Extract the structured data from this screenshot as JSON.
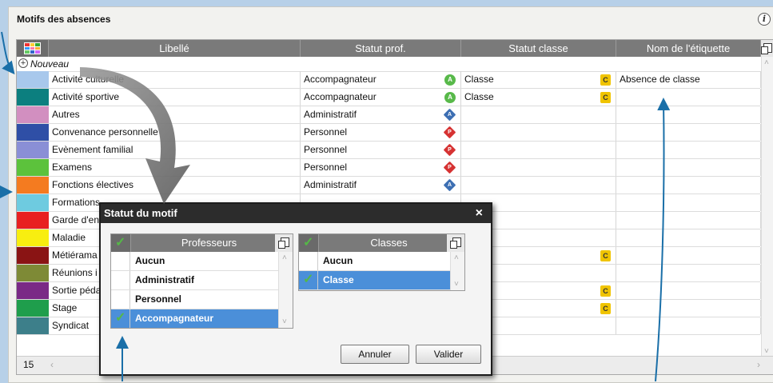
{
  "panel": {
    "title": "Motifs des absences",
    "info_icon": "info-icon"
  },
  "table": {
    "columns": [
      "Libellé",
      "Statut prof.",
      "Statut classe",
      "Nom de l'étiquette"
    ],
    "new_label": "Nouveau",
    "rows": [
      {
        "color": "#a8c8ec",
        "label": "Activité culturelle",
        "prof": "Accompagnateur",
        "prof_badge": "circle",
        "prof_letter": "A",
        "classe": "Classe",
        "classe_badge": "C",
        "etiquette": "Absence de classe"
      },
      {
        "color": "#0c7f7f",
        "label": "Activité sportive",
        "prof": "Accompagnateur",
        "prof_badge": "circle",
        "prof_letter": "A",
        "classe": "Classe",
        "classe_badge": "C",
        "etiquette": ""
      },
      {
        "color": "#d28fc0",
        "label": "Autres",
        "prof": "Administratif",
        "prof_badge": "diamond-blue",
        "prof_letter": "A",
        "classe": "",
        "classe_badge": "",
        "etiquette": ""
      },
      {
        "color": "#2f4fa6",
        "label": "Convenance personnelle",
        "prof": "Personnel",
        "prof_badge": "diamond-red",
        "prof_letter": "P",
        "classe": "",
        "classe_badge": "",
        "etiquette": ""
      },
      {
        "color": "#8a8fd6",
        "label": "Evènement familial",
        "prof": "Personnel",
        "prof_badge": "diamond-red",
        "prof_letter": "P",
        "classe": "",
        "classe_badge": "",
        "etiquette": ""
      },
      {
        "color": "#5cc23c",
        "label": "Examens",
        "prof": "Personnel",
        "prof_badge": "diamond-red",
        "prof_letter": "P",
        "classe": "",
        "classe_badge": "",
        "etiquette": ""
      },
      {
        "color": "#f47b20",
        "label": "Fonctions électives",
        "prof": "Administratif",
        "prof_badge": "diamond-blue",
        "prof_letter": "A",
        "classe": "",
        "classe_badge": "",
        "etiquette": ""
      },
      {
        "color": "#6ecbe0",
        "label": "Formations",
        "prof": "",
        "prof_badge": "",
        "prof_letter": "",
        "classe": "",
        "classe_badge": "",
        "etiquette": ""
      },
      {
        "color": "#e82020",
        "label": "Garde d'en",
        "prof": "",
        "prof_badge": "",
        "prof_letter": "",
        "classe": "",
        "classe_badge": "",
        "etiquette": ""
      },
      {
        "color": "#f8ee10",
        "label": "Maladie",
        "prof": "",
        "prof_badge": "",
        "prof_letter": "",
        "classe": "",
        "classe_badge": "",
        "etiquette": ""
      },
      {
        "color": "#8a1414",
        "label": "Métiérama",
        "prof": "",
        "prof_badge": "",
        "prof_letter": "",
        "classe": "",
        "classe_badge": "C",
        "etiquette": ""
      },
      {
        "color": "#7e8a36",
        "label": "Réunions i",
        "prof": "",
        "prof_badge": "",
        "prof_letter": "",
        "classe": "",
        "classe_badge": "",
        "etiquette": ""
      },
      {
        "color": "#7a2a86",
        "label": "Sortie péda",
        "prof": "",
        "prof_badge": "",
        "prof_letter": "",
        "classe": "",
        "classe_badge": "C",
        "etiquette": ""
      },
      {
        "color": "#1f9e4c",
        "label": "Stage",
        "prof": "",
        "prof_badge": "",
        "prof_letter": "",
        "classe": "",
        "classe_badge": "C",
        "etiquette": ""
      },
      {
        "color": "#3d7f8a",
        "label": "Syndicat",
        "prof": "",
        "prof_badge": "",
        "prof_letter": "",
        "classe": "",
        "classe_badge": "",
        "etiquette": ""
      }
    ],
    "count": "15"
  },
  "dialog": {
    "title": "Statut du motif",
    "close": "×",
    "professeurs": {
      "header": "Professeurs",
      "items": [
        {
          "label": "Aucun",
          "checked": false,
          "selected": false
        },
        {
          "label": "Administratif",
          "checked": false,
          "selected": false
        },
        {
          "label": "Personnel",
          "checked": false,
          "selected": false
        },
        {
          "label": "Accompagnateur",
          "checked": true,
          "selected": true
        }
      ]
    },
    "classes": {
      "header": "Classes",
      "items": [
        {
          "label": "Aucun",
          "checked": false,
          "selected": false
        },
        {
          "label": "Classe",
          "checked": true,
          "selected": true
        }
      ]
    },
    "cancel_label": "Annuler",
    "ok_label": "Valider"
  },
  "colors": {
    "accent": "#4b8fd9",
    "header_bg": "#7a7a7a",
    "check": "#55b847",
    "arrow": "#1a6fa8"
  }
}
